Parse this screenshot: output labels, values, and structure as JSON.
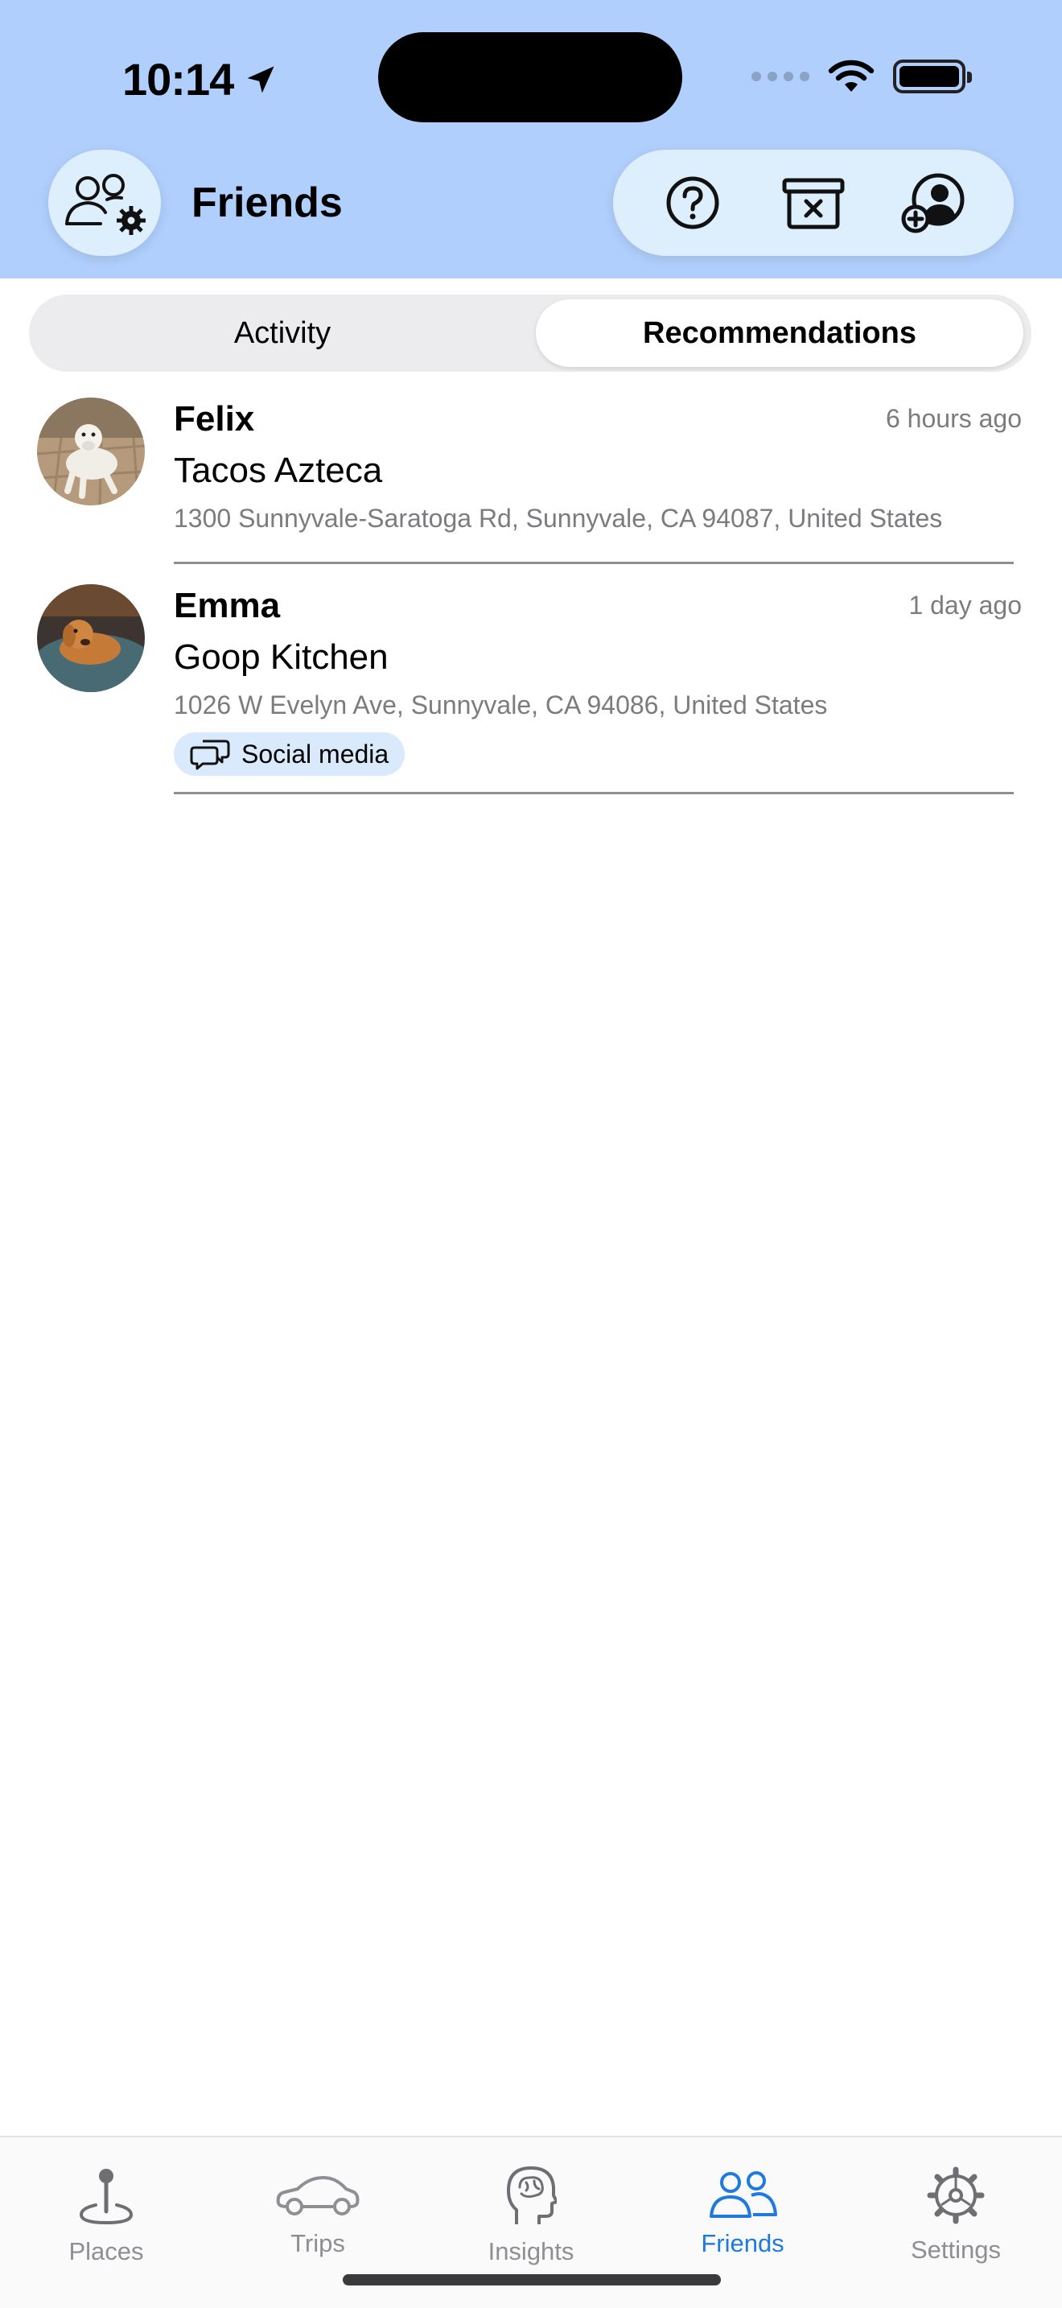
{
  "status_bar": {
    "time": "10:14"
  },
  "header": {
    "title": "Friends"
  },
  "segment": {
    "tabs": [
      {
        "label": "Activity"
      },
      {
        "label": "Recommendations"
      }
    ]
  },
  "recommendations": [
    {
      "friend": "Felix",
      "time": "6 hours ago",
      "place": "Tacos Azteca",
      "address": "1300 Sunnyvale-Saratoga Rd, Sunnyvale, CA  94087, United States"
    },
    {
      "friend": "Emma",
      "time": "1 day ago",
      "place": "Goop Kitchen",
      "address": "1026 W Evelyn Ave, Sunnyvale, CA  94086, United States",
      "tag": "Social media"
    }
  ],
  "tabbar": {
    "items": [
      {
        "label": "Places",
        "icon": "pin-icon"
      },
      {
        "label": "Trips",
        "icon": "car-icon"
      },
      {
        "label": "Insights",
        "icon": "brain-head-icon"
      },
      {
        "label": "Friends",
        "icon": "friends-icon"
      },
      {
        "label": "Settings",
        "icon": "gear-icon"
      }
    ],
    "active": "Friends"
  },
  "colors": {
    "header_bg": "#b0cffc",
    "accent": "#1f7ae0",
    "tag_bg": "#d8eafb"
  }
}
